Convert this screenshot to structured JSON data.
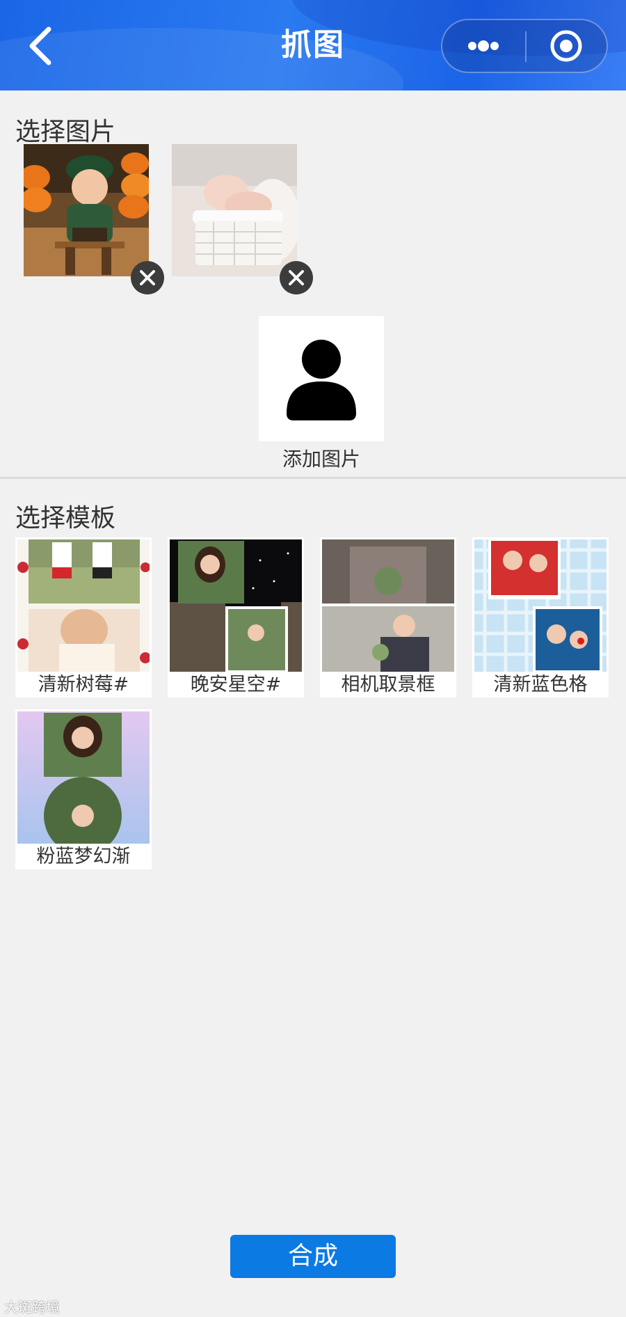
{
  "header": {
    "title": "抓图"
  },
  "select_images": {
    "title": "选择图片",
    "images": [
      {
        "name": "baby-with-pumpkins"
      },
      {
        "name": "newborn-in-basket"
      }
    ],
    "add_label": "添加图片"
  },
  "select_template": {
    "title": "选择模板",
    "templates": [
      {
        "label": "清新树莓#"
      },
      {
        "label": "晚安星空#"
      },
      {
        "label": "相机取景框"
      },
      {
        "label": "清新蓝色格"
      },
      {
        "label": "粉蓝梦幻渐"
      }
    ]
  },
  "actions": {
    "merge_label": "合成"
  },
  "watermark": {
    "text": "大斑跨境"
  },
  "colors": {
    "header": "#1f6ee8",
    "primary_button": "#0b7ae3",
    "background": "#f1f1f1"
  }
}
